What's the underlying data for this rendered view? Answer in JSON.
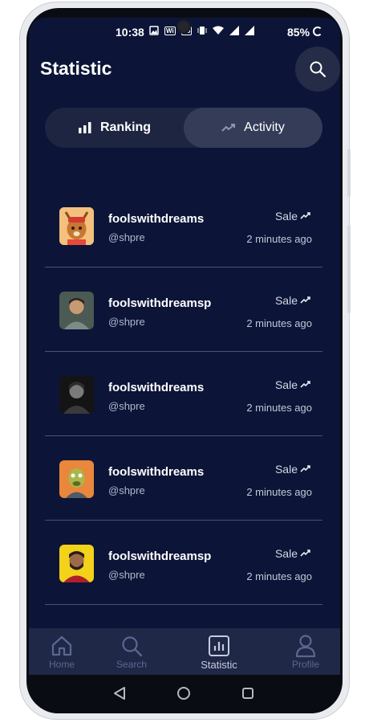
{
  "status_bar": {
    "time": "10:38",
    "battery": "85%",
    "icons": [
      "gallery-icon",
      "wifi-calling-icon",
      "volte-icon",
      "vibrate-icon",
      "wifi-icon",
      "signal-icon",
      "signal-icon",
      "battery-ring-icon"
    ]
  },
  "header": {
    "title": "Statistic",
    "search_icon": "search-icon"
  },
  "segments": [
    {
      "label": "Ranking",
      "icon": "bar-chart-icon",
      "active": false
    },
    {
      "label": "Activity",
      "icon": "trend-up-icon",
      "active": true
    }
  ],
  "activity": [
    {
      "name": "foolswithdreams",
      "handle": "@shpre",
      "event": "Sale",
      "time": "2 minutes ago",
      "avatar": "deer-avatar"
    },
    {
      "name": "foolswithdreamsp",
      "handle": "@shpre",
      "event": "Sale",
      "time": "2 minutes ago",
      "avatar": "man-avatar"
    },
    {
      "name": "foolswithdreams",
      "handle": "@shpre",
      "event": "Sale",
      "time": "2 minutes ago",
      "avatar": "portrait-avatar"
    },
    {
      "name": "foolswithdreams",
      "handle": "@shpre",
      "event": "Sale",
      "time": "2 minutes ago",
      "avatar": "ape-avatar"
    },
    {
      "name": "foolswithdreamsp",
      "handle": "@shpre",
      "event": "Sale",
      "time": "2 minutes ago",
      "avatar": "bearded-man-avatar"
    }
  ],
  "tabbar": [
    {
      "label": "Home",
      "icon": "home-icon",
      "active": false
    },
    {
      "label": "Search",
      "icon": "search-icon",
      "active": false
    },
    {
      "label": "Statistic",
      "icon": "chart-icon",
      "active": true
    },
    {
      "label": "Profile",
      "icon": "user-icon",
      "active": false
    }
  ],
  "colors": {
    "background": "#0c1538",
    "segment_bg": "#1d2540",
    "segment_active": "#343c58",
    "tabbar_bg": "#1f2846",
    "tab_inactive": "#5b6791",
    "tab_active": "#c7cbe0"
  }
}
